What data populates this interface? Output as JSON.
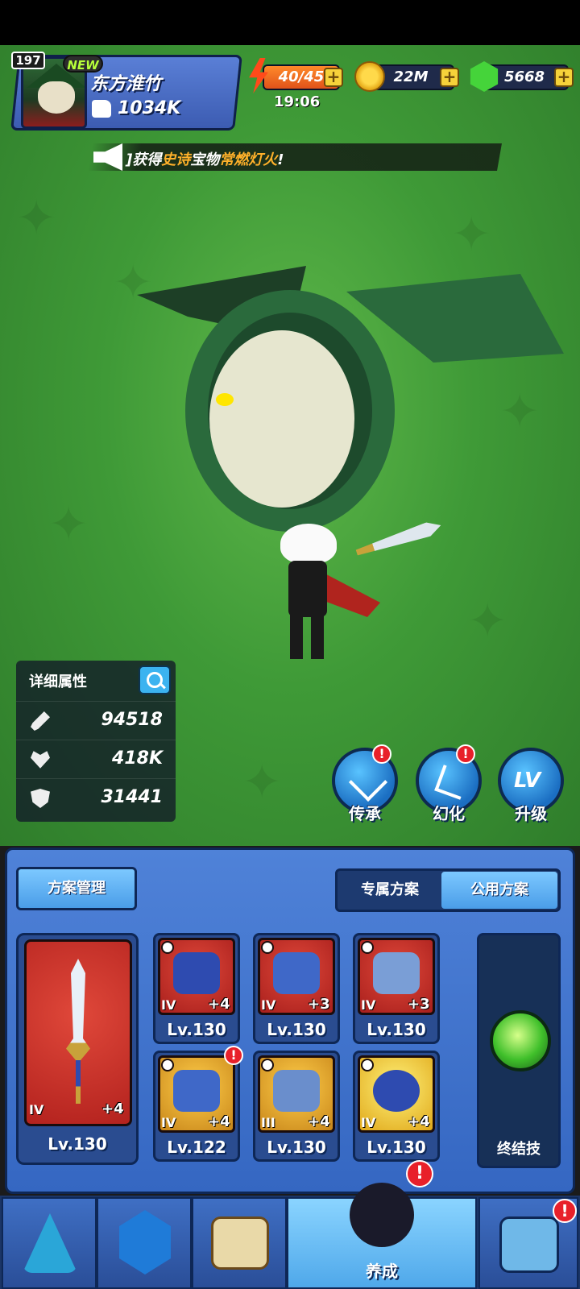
{
  "player": {
    "level": "197",
    "new_badge": "NEW",
    "name": "东方淮竹",
    "power": "1034K"
  },
  "resources": {
    "energy": "40/45",
    "energy_timer": "19:06",
    "gold": "22M",
    "gems": "5668",
    "plus_symbol": "+"
  },
  "ticker": {
    "prefix": "]获得",
    "rarity": "史诗",
    "middle": "宝物",
    "item": "常燃灯火",
    "suffix": "!"
  },
  "stats": {
    "title": "详细属性",
    "attack": "94518",
    "hp": "418K",
    "defense": "31441"
  },
  "actions": {
    "inherit": "传承",
    "transform": "幻化",
    "upgrade": "升级",
    "lv_text": "LV",
    "alert": "!"
  },
  "plan": {
    "manage": "方案管理",
    "exclusive": "专属方案",
    "public": "公用方案"
  },
  "weapon": {
    "tier": "IV",
    "plus": "+4",
    "level": "Lv.130"
  },
  "equipment": [
    {
      "tier": "IV",
      "plus": "+4",
      "level": "Lv.130",
      "rarity": "red"
    },
    {
      "tier": "IV",
      "plus": "+3",
      "level": "Lv.130",
      "rarity": "red"
    },
    {
      "tier": "IV",
      "plus": "+3",
      "level": "Lv.130",
      "rarity": "red"
    },
    {
      "tier": "IV",
      "plus": "+4",
      "level": "Lv.122",
      "rarity": "gold"
    },
    {
      "tier": "III",
      "plus": "+4",
      "level": "Lv.130",
      "rarity": "gold"
    },
    {
      "tier": "IV",
      "plus": "+4",
      "level": "Lv.130",
      "rarity": "gold"
    }
  ],
  "ultimate": {
    "label": "终结技"
  },
  "nav": {
    "active_label": "养成"
  },
  "colors": {
    "scene_green": "#3f9a37",
    "panel_blue": "#3567c2",
    "card_red": "#b3221e",
    "card_gold": "#c8861a",
    "alert_red": "#e8202a",
    "highlight_orange": "#ffb12a"
  }
}
